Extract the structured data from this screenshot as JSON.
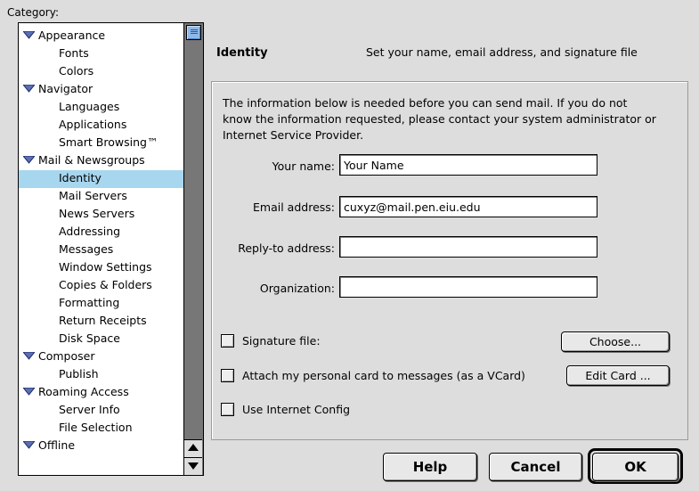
{
  "category_label": "Category:",
  "categories": [
    {
      "label": "Appearance",
      "level": 0
    },
    {
      "label": "Fonts",
      "level": 1
    },
    {
      "label": "Colors",
      "level": 1
    },
    {
      "label": "Navigator",
      "level": 0
    },
    {
      "label": "Languages",
      "level": 1
    },
    {
      "label": "Applications",
      "level": 1
    },
    {
      "label": "Smart Browsing™",
      "level": 1
    },
    {
      "label": "Mail & Newsgroups",
      "level": 0
    },
    {
      "label": "Identity",
      "level": 1,
      "selected": true
    },
    {
      "label": "Mail Servers",
      "level": 1
    },
    {
      "label": "News Servers",
      "level": 1
    },
    {
      "label": "Addressing",
      "level": 1
    },
    {
      "label": "Messages",
      "level": 1
    },
    {
      "label": "Window Settings",
      "level": 1
    },
    {
      "label": "Copies & Folders",
      "level": 1
    },
    {
      "label": "Formatting",
      "level": 1
    },
    {
      "label": "Return Receipts",
      "level": 1
    },
    {
      "label": "Disk Space",
      "level": 1
    },
    {
      "label": "Composer",
      "level": 0
    },
    {
      "label": "Publish",
      "level": 1
    },
    {
      "label": "Roaming Access",
      "level": 0
    },
    {
      "label": "Server Info",
      "level": 1
    },
    {
      "label": "File Selection",
      "level": 1
    },
    {
      "label": "Offline",
      "level": 0
    }
  ],
  "panel": {
    "title": "Identity",
    "description": "Set your name, email address, and signature file",
    "info_text": "The information below is needed before you can send mail. If you do not know the information requested, please contact your system administrator or Internet Service Provider."
  },
  "fields": {
    "name": {
      "label": "Your name:",
      "value": "Your Name"
    },
    "email": {
      "label": "Email address:",
      "value": "cuxyz@mail.pen.eiu.edu"
    },
    "reply_to": {
      "label": "Reply-to address:",
      "value": ""
    },
    "organization": {
      "label": "Organization:",
      "value": ""
    }
  },
  "checkboxes": {
    "signature": {
      "label": "Signature file:",
      "checked": false
    },
    "vcard": {
      "label": "Attach my personal card to messages (as a VCard)",
      "checked": false
    },
    "internet_config": {
      "label": "Use Internet Config",
      "checked": false
    }
  },
  "buttons": {
    "choose": "Choose...",
    "edit_card": "Edit Card ...",
    "help": "Help",
    "cancel": "Cancel",
    "ok": "OK"
  },
  "icons": {
    "expand": "disclosure-triangle-down-icon",
    "scroll_up": "arrow-up-icon",
    "scroll_down": "arrow-down-icon"
  },
  "colors": {
    "selection": "#a7d6ef",
    "scroll_thumb": "#8fb8e8",
    "window_bg": "#dddddd"
  }
}
